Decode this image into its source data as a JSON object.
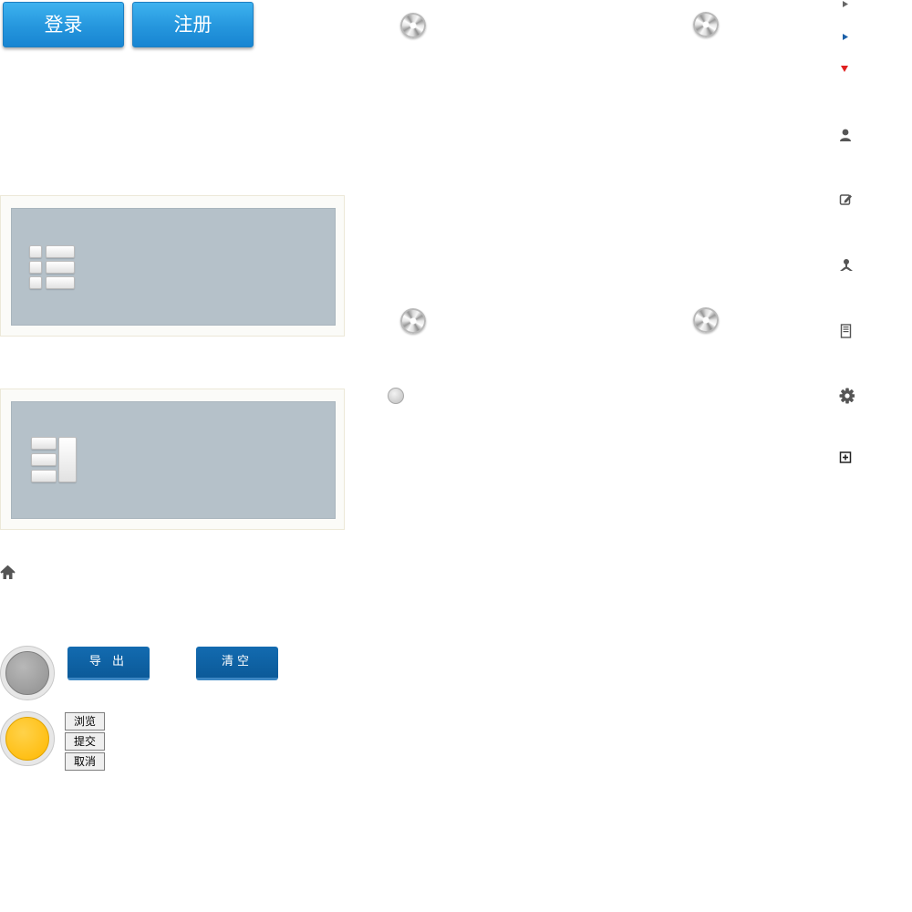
{
  "top_buttons": {
    "login_label": "登录",
    "register_label": "注册"
  },
  "layout_panels": [
    {
      "name": "list-layout"
    },
    {
      "name": "split-layout"
    }
  ],
  "knobs": [
    "knob",
    "knob",
    "knob",
    "knob"
  ],
  "side_icons": [
    "triangle-right-gray-icon",
    "triangle-right-blue-icon",
    "triangle-down-red-icon",
    "user-icon",
    "edit-icon",
    "org-chart-icon",
    "document-icon",
    "gear-icon",
    "add-icon"
  ],
  "home_icon": "home-icon",
  "status_lights": [
    {
      "state": "off",
      "color": "#a3a3a3"
    },
    {
      "state": "on",
      "color": "#ffc21a"
    }
  ],
  "action_buttons": {
    "export_label": "导 出",
    "clear_label": "清空"
  },
  "form_buttons": {
    "browse_label": "浏览",
    "submit_label": "提交",
    "cancel_label": "取消"
  },
  "colors": {
    "primary_blue": "#2596dd",
    "dark_blue": "#0b5a99",
    "panel_gray": "#b5c1c9",
    "accent_red": "#e02020",
    "accent_yellow": "#ffc21a"
  }
}
